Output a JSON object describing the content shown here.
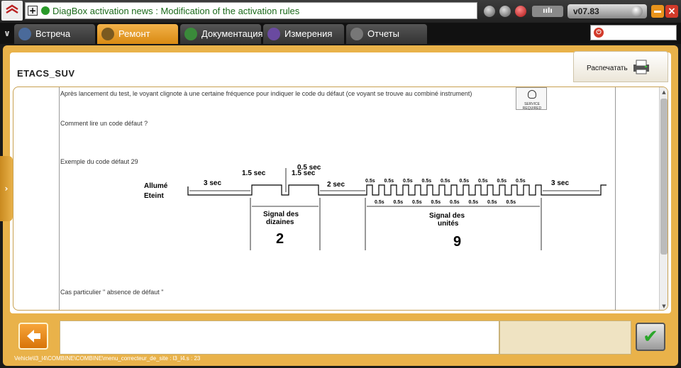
{
  "news": {
    "text": "DiagBox activation news : Modification of the activation rules"
  },
  "version": "v07.83",
  "battery": "ıılı",
  "tabs": [
    {
      "label": "Встреча",
      "icon": "meeting-icon",
      "color": "#4a6a9a"
    },
    {
      "label": "Ремонт",
      "icon": "magnifier-icon",
      "color": "#7a5a20"
    },
    {
      "label": "Документация",
      "icon": "book-icon",
      "color": "#3a8a3a"
    },
    {
      "label": "Измерения",
      "icon": "wave-icon",
      "color": "#6a4aa0"
    },
    {
      "label": "Отчеты",
      "icon": "report-icon",
      "color": "#777777"
    }
  ],
  "module": {
    "title": "ETACS_SUV"
  },
  "print": {
    "label": "Распечатать"
  },
  "doc": {
    "line1": "Après lancement du test, le voyant clignote à une certaine fréquence pour indiquer le code du défaut (ce voyant se trouve au combiné instrument)",
    "line2": "Comment lire un code défaut ?",
    "line3": "Exemple du code défaut 29",
    "line4": "Cas particulier \" absence de défaut \"",
    "service_label": "SERVICE REQUIRED"
  },
  "diagram": {
    "on_label": "Allumé",
    "off_label": "Eteint",
    "t_3sec": "3 sec",
    "t_15sec": "1.5 sec",
    "t_05sec": "0.5 sec",
    "t_2sec": "2 sec",
    "t_05s": "0.5s",
    "tens_label_1": "Signal des",
    "tens_label_2": "dizaines",
    "tens_value": "2",
    "units_label_1": "Signal des",
    "units_label_2": "unités",
    "units_value": "9"
  },
  "status": "Vehicle\\l3_l4\\COMBINE\\COMBINE\\menu_correcteur_de_site : l3_l4.s : 23",
  "colors": {
    "accent": "#e9b24a",
    "active_tab": "#e39a22",
    "news_text": "#1b6a1b"
  }
}
